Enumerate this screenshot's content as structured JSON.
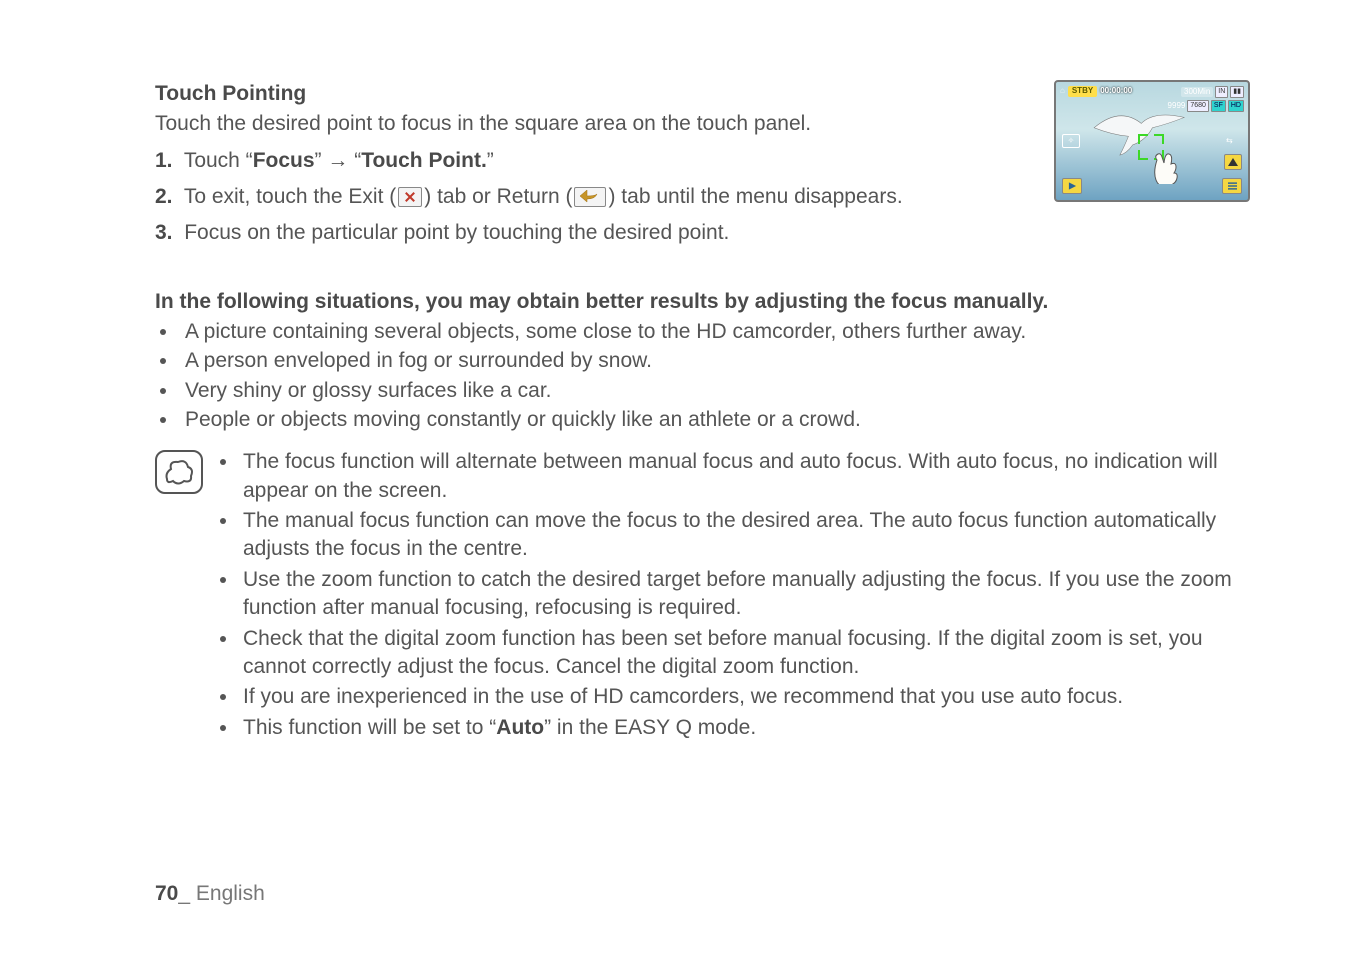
{
  "section": {
    "title": "Touch Pointing",
    "intro": "Touch the desired point to focus in the square area on the touch panel."
  },
  "steps": [
    {
      "num": "1.",
      "pre": "Touch “",
      "b1": "Focus",
      "mid": "” → “",
      "b2": "Touch Point.",
      "post": "”"
    },
    {
      "num": "2.",
      "pre": "To exit, touch the Exit (",
      "mid": ") tab or Return (",
      "post": ") tab until the menu disappears."
    },
    {
      "num": "3.",
      "text": "Focus on the particular point by touching the desired point."
    }
  ],
  "manual": {
    "heading": "In the following situations, you may obtain better results by adjusting the focus manually.",
    "bullets": [
      "A picture containing several objects, some close to the HD camcorder, others further away.",
      "A person enveloped in fog or surrounded by snow.",
      "Very shiny or glossy surfaces like a car.",
      "People or objects moving constantly or quickly like an athlete or a crowd."
    ]
  },
  "notes": [
    "The focus function will alternate between manual focus and auto focus. With auto focus, no indication will appear on the screen.",
    "The manual focus function can move the focus to the desired area. The auto focus function automatically adjusts the focus in the centre.",
    "Use the zoom function to catch the desired target before manually adjusting the focus. If you use the zoom function after manual focusing, refocusing is required.",
    "Check that the digital zoom function has been set before manual focusing. If the digital zoom is set, you cannot correctly adjust the focus. Cancel the digital zoom function.",
    "If you are inexperienced in the use of HD camcorders, we recommend that you use auto focus."
  ],
  "note_last": {
    "pre": "This function will be set to “",
    "bold": "Auto",
    "post": "” in the EASY Q mode."
  },
  "thumbnail": {
    "stby": "STBY",
    "timer": "00:00:00",
    "remain": "300Min",
    "count": "9999",
    "badge_in": "IN",
    "badge_7680": "7680",
    "badge_sf": "SF",
    "badge_hd": "HD"
  },
  "footer": {
    "page": "70",
    "sep": "_",
    "lang": "English"
  }
}
